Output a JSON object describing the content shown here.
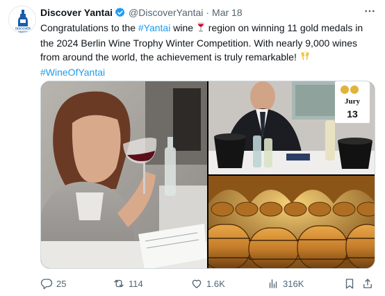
{
  "tweet": {
    "display_name": "Discover Yantai",
    "handle": "@DiscoverYantai",
    "separator": "·",
    "date": "Mar 18",
    "more_icon": "more-dots-icon",
    "avatar_text": "DISCOVER YANTAI",
    "text": {
      "line1_pre": "Congratulations to the ",
      "line1_hashtag": "#Yantai",
      "line1_mid": " wine ",
      "line1_post": " region on winning 11 gold medals in",
      "line2": "the 2024 Berlin Wine Trophy Winter Competition. With nearly 9,000 wines",
      "line3": "from around the world, the achievement is truly remarkable! ",
      "line4_hashtag": "#WineOfYantai"
    },
    "media": {
      "photos": [
        "woman-tasting-wine-photo",
        "jury-table-photo",
        "wine-barrels-photo"
      ],
      "jury_sign_label": "Jury",
      "jury_sign_number": "13"
    },
    "actions": {
      "replies": "25",
      "reposts": "114",
      "likes": "1.6K",
      "views": "316K"
    },
    "colors": {
      "link": "#1d9bf0",
      "secondary_text": "#536471",
      "verified": "#1d9bf0"
    }
  }
}
